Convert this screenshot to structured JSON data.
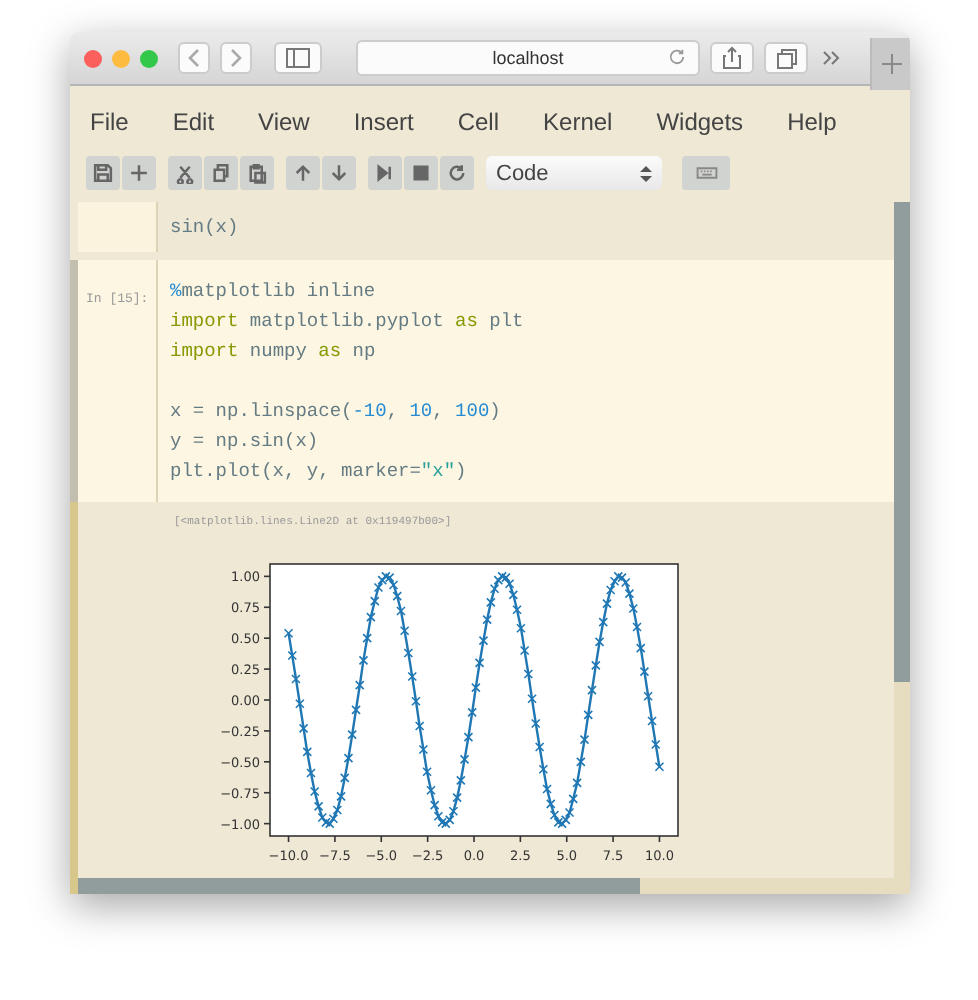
{
  "browser": {
    "address": "localhost"
  },
  "menu": [
    "File",
    "Edit",
    "View",
    "Insert",
    "Cell",
    "Kernel",
    "Widgets",
    "Help"
  ],
  "toolbar": {
    "groups": [
      [
        {
          "kind": "save"
        },
        {
          "kind": "add"
        }
      ],
      [
        {
          "kind": "cut"
        },
        {
          "kind": "copy"
        },
        {
          "kind": "paste"
        }
      ],
      [
        {
          "kind": "up"
        },
        {
          "kind": "down"
        }
      ],
      [
        {
          "kind": "run"
        },
        {
          "kind": "stop"
        },
        {
          "kind": "restart"
        }
      ]
    ],
    "cell_type": "Code",
    "extra": {
      "kind": "keyboard"
    }
  },
  "cells": [
    {
      "selected": false,
      "blocks": [
        [
          [
            {
              "text": "sin(x)",
              "kind": "plain"
            }
          ]
        ]
      ]
    },
    {
      "prompt": "In [15]:",
      "selected": true,
      "blocks": [
        [
          [
            {
              "text": "%",
              "kind": "magic"
            },
            {
              "text": "matplotlib inline",
              "kind": "plain"
            }
          ],
          [
            {
              "text": "import",
              "kind": "keyword"
            },
            {
              "text": " matplotlib.pyplot ",
              "kind": "plain"
            },
            {
              "text": "as",
              "kind": "keyword"
            },
            {
              "text": " plt",
              "kind": "plain"
            }
          ],
          [
            {
              "text": "import",
              "kind": "keyword"
            },
            {
              "text": " numpy ",
              "kind": "plain"
            },
            {
              "text": "as",
              "kind": "keyword"
            },
            {
              "text": " np",
              "kind": "plain"
            }
          ]
        ],
        [
          [
            {
              "text": "x = np.linspace(",
              "kind": "plain"
            },
            {
              "text": "-10",
              "kind": "number"
            },
            {
              "text": ", ",
              "kind": "plain"
            },
            {
              "text": "10",
              "kind": "number"
            },
            {
              "text": ", ",
              "kind": "plain"
            },
            {
              "text": "100",
              "kind": "number"
            },
            {
              "text": ")",
              "kind": "plain"
            }
          ],
          [
            {
              "text": "y = np.sin(x)",
              "kind": "plain"
            }
          ],
          [
            {
              "text": "plt.plot(x, y, marker=",
              "kind": "plain"
            },
            {
              "text": "\"x\"",
              "kind": "string"
            },
            {
              "text": ")",
              "kind": "plain"
            }
          ]
        ]
      ]
    }
  ],
  "output": {
    "text": "[<matplotlib.lines.Line2D at 0x119497b00>]",
    "chart_data": {
      "type": "line",
      "xlim": [
        -11,
        11
      ],
      "ylim": [
        -1.1,
        1.1
      ],
      "xticks": [
        {
          "value": -10,
          "label": "−10.0"
        },
        {
          "value": -7.5,
          "label": "−7.5"
        },
        {
          "value": -5,
          "label": "−5.0"
        },
        {
          "value": -2.5,
          "label": "−2.5"
        },
        {
          "value": 0,
          "label": "0.0"
        },
        {
          "value": 2.5,
          "label": "2.5"
        },
        {
          "value": 5,
          "label": "5.0"
        },
        {
          "value": 7.5,
          "label": "7.5"
        },
        {
          "value": 10,
          "label": "10.0"
        }
      ],
      "yticks": [
        {
          "value": 1,
          "label": "1.00"
        },
        {
          "value": 0.75,
          "label": "0.75"
        },
        {
          "value": 0.5,
          "label": "0.50"
        },
        {
          "value": 0.25,
          "label": "0.25"
        },
        {
          "value": 0,
          "label": "0.00"
        },
        {
          "value": -0.25,
          "label": "−0.25"
        },
        {
          "value": -0.5,
          "label": "−0.50"
        },
        {
          "value": -0.75,
          "label": "−0.75"
        },
        {
          "value": -1,
          "label": "−1.00"
        }
      ],
      "x": [
        -10,
        -9.8,
        -9.6,
        -9.39,
        -9.19,
        -8.99,
        -8.79,
        -8.59,
        -8.38,
        -8.18,
        -7.98,
        -7.78,
        -7.58,
        -7.37,
        -7.17,
        -6.97,
        -6.77,
        -6.57,
        -6.36,
        -6.16,
        -5.96,
        -5.76,
        -5.56,
        -5.35,
        -5.15,
        -4.95,
        -4.75,
        -4.55,
        -4.34,
        -4.14,
        -3.94,
        -3.74,
        -3.54,
        -3.33,
        -3.13,
        -2.93,
        -2.73,
        -2.53,
        -2.32,
        -2.12,
        -1.92,
        -1.72,
        -1.52,
        -1.31,
        -1.11,
        -0.91,
        -0.71,
        -0.51,
        -0.3,
        -0.1,
        0.1,
        0.3,
        0.51,
        0.71,
        0.91,
        1.11,
        1.31,
        1.52,
        1.72,
        1.92,
        2.12,
        2.32,
        2.53,
        2.73,
        2.93,
        3.13,
        3.33,
        3.54,
        3.74,
        3.94,
        4.14,
        4.34,
        4.55,
        4.75,
        4.95,
        5.15,
        5.35,
        5.56,
        5.76,
        5.96,
        6.16,
        6.36,
        6.57,
        6.77,
        6.97,
        7.17,
        7.37,
        7.58,
        7.78,
        7.98,
        8.18,
        8.38,
        8.59,
        8.79,
        8.99,
        9.19,
        9.39,
        9.6,
        9.8,
        10
      ],
      "series": [
        {
          "color": "#1f77b4",
          "marker": "x",
          "values": [
            0.54,
            0.36,
            0.17,
            -0.03,
            -0.23,
            -0.42,
            -0.59,
            -0.74,
            -0.86,
            -0.95,
            -0.99,
            -1.0,
            -0.96,
            -0.89,
            -0.78,
            -0.63,
            -0.47,
            -0.28,
            -0.08,
            0.12,
            0.32,
            0.5,
            0.67,
            0.8,
            0.91,
            0.97,
            1.0,
            0.99,
            0.93,
            0.84,
            0.72,
            0.56,
            0.38,
            0.19,
            -0.01,
            -0.21,
            -0.4,
            -0.58,
            -0.73,
            -0.85,
            -0.94,
            -0.99,
            -1.0,
            -0.97,
            -0.9,
            -0.79,
            -0.65,
            -0.48,
            -0.3,
            -0.1,
            0.1,
            0.3,
            0.48,
            0.65,
            0.79,
            0.9,
            0.97,
            1.0,
            0.99,
            0.94,
            0.85,
            0.73,
            0.58,
            0.4,
            0.21,
            0.01,
            -0.19,
            -0.38,
            -0.56,
            -0.72,
            -0.84,
            -0.93,
            -0.99,
            -1.0,
            -0.97,
            -0.91,
            -0.8,
            -0.67,
            -0.5,
            -0.32,
            -0.12,
            0.08,
            0.28,
            0.47,
            0.63,
            0.78,
            0.89,
            0.96,
            1.0,
            0.99,
            0.95,
            0.86,
            0.74,
            0.59,
            0.42,
            0.23,
            0.03,
            -0.17,
            -0.36,
            -0.54
          ]
        }
      ]
    }
  }
}
